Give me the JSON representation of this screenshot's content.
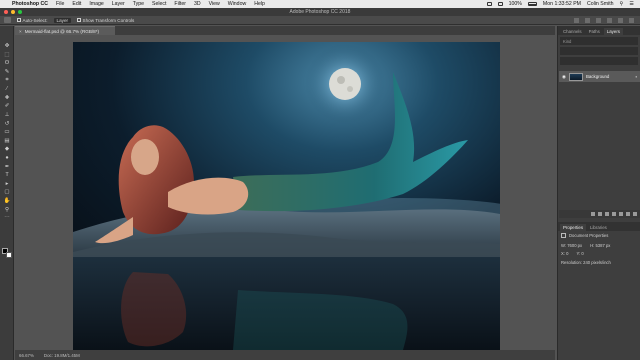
{
  "menubar": {
    "app_name": "Photoshop CC",
    "items": [
      "File",
      "Edit",
      "Image",
      "Layer",
      "Type",
      "Select",
      "Filter",
      "3D",
      "View",
      "Window",
      "Help"
    ],
    "battery": "100%",
    "clock": "Mon 1:33:52 PM",
    "user": "Colin Smith"
  },
  "window": {
    "title": "Adobe Photoshop CC 2018"
  },
  "options_bar": {
    "auto_select_label": "Auto-Select:",
    "auto_select_value": "Layer",
    "transform_label": "Show Transform Controls"
  },
  "document": {
    "tab_title": "Mermaid-flat.psd @ 66.7% (RGB/8*)",
    "zoom": "66.67%",
    "doc_info": "Doc: 19.8M/1.45M"
  },
  "layers_panel": {
    "tabs": [
      "Channels",
      "Paths",
      "Layers"
    ],
    "active_tab": "Layers",
    "layer_name": "Background",
    "kind_label": "Kind"
  },
  "properties_panel": {
    "tabs": [
      "Properties",
      "Libraries"
    ],
    "active_tab": "Properties",
    "header": "Document Properties",
    "w": "W: 7600 px",
    "h": "H: 5387 px",
    "x": "X: 0",
    "y": "Y: 0",
    "resolution": "Resolution: 240 pixels/inch"
  },
  "colors": {
    "close": "#ff5f57",
    "minimize": "#febc2e",
    "maximize": "#28c840",
    "foreground": "#000000",
    "background": "#ffffff"
  }
}
